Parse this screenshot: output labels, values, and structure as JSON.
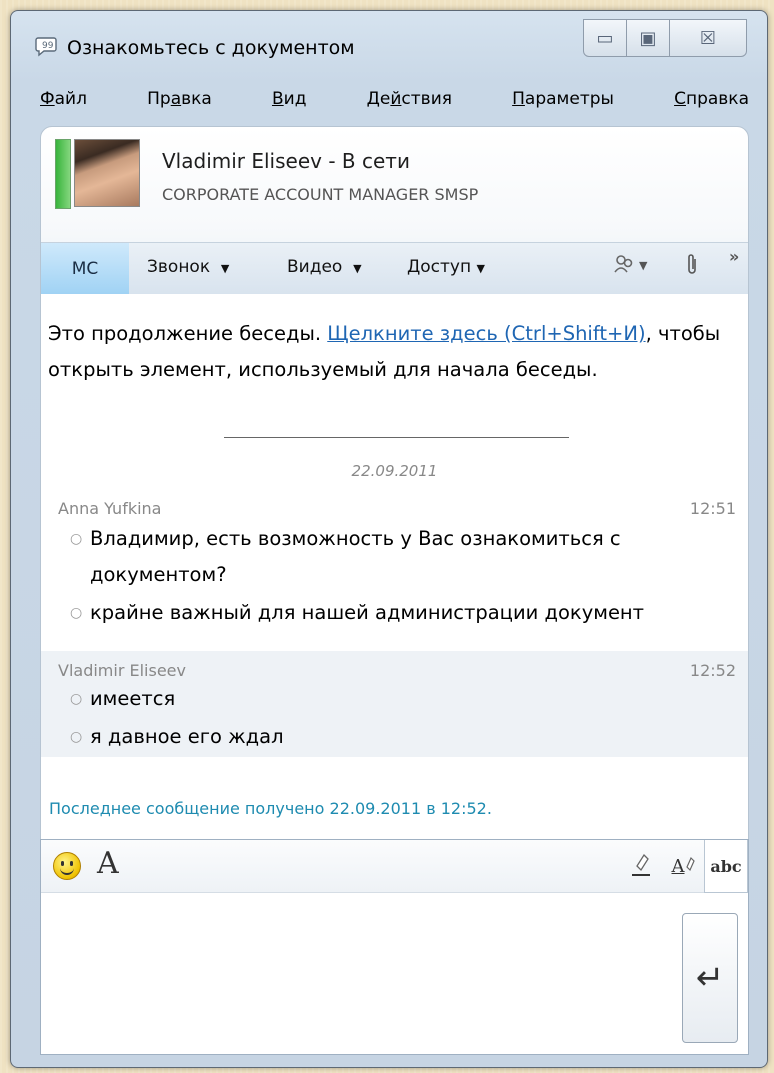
{
  "window": {
    "title": "Ознакомьтесь с документом",
    "controls": {
      "minimize": "▭",
      "restore": "▣",
      "close": "☒"
    }
  },
  "menu": [
    {
      "label": "Файл",
      "accel": "Ф",
      "rest": "айл"
    },
    {
      "label": "Правка",
      "accel": "а",
      "pre": "Пр",
      "rest": "вка"
    },
    {
      "label": "Вид",
      "accel": "В",
      "rest": "ид"
    },
    {
      "label": "Действия",
      "accel": "й",
      "pre": "Де",
      "rest": "ствия"
    },
    {
      "label": "Параметры",
      "accel": "П",
      "rest": "араметры"
    },
    {
      "label": "Справка",
      "accel": "С",
      "rest": "правка"
    }
  ],
  "contact": {
    "name_status": "Vladimir Eliseev - В сети",
    "title": "CORPORATE ACCOUNT MANAGER SMSP",
    "presence_color": "#38b43c"
  },
  "toolbar": {
    "tab": "МС",
    "call": "Звонок",
    "video": "Видео",
    "share": "Доступ",
    "more": "»"
  },
  "conversation": {
    "intro_text": "Это продолжение беседы. ",
    "intro_link": "Щелкните здесь (Ctrl+Shift+И)",
    "intro_rest": ", чтобы открыть элемент, используемый для начала беседы.",
    "date": "22.09.2011",
    "messages": [
      {
        "sender": "Anna Yufkina",
        "time": "12:51",
        "lines": [
          "Владимир, есть возможность у Вас ознакомиться с документом?",
          "крайне важный для нашей администрации документ"
        ]
      },
      {
        "sender": "Vladimir Eliseev",
        "time": "12:52",
        "lines": [
          "имеется",
          "я давное его ждал"
        ]
      }
    ],
    "last_received": "Последнее сообщение получено 22.09.2011 в 12:52."
  },
  "compose": {
    "font_glyph": "A",
    "spell_glyph": "abc",
    "send_glyph": "↵"
  },
  "icons": [
    "chat-window-icon",
    "emoticon-icon",
    "font-icon",
    "highlight-icon",
    "text-color-icon",
    "spellcheck-icon",
    "attach-icon",
    "people-icon",
    "send-icon"
  ]
}
